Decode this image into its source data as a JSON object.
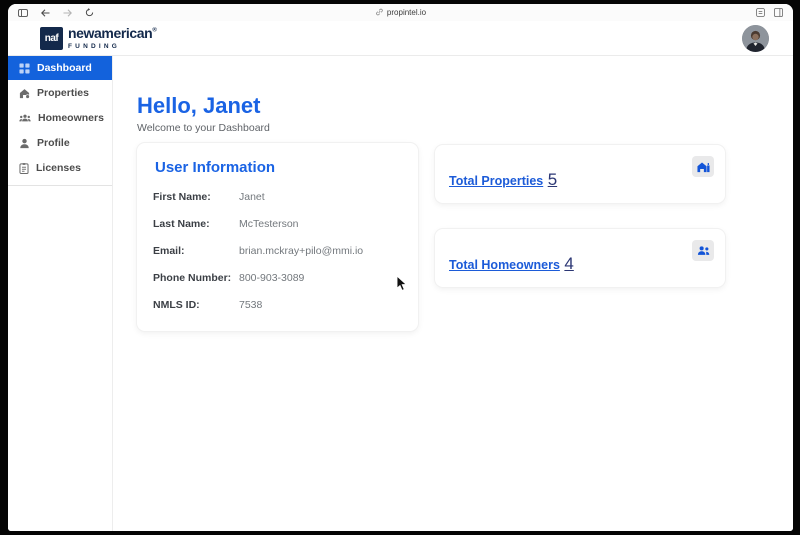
{
  "browser": {
    "url": "propintel.io",
    "icons": [
      "sidebar-toggle-icon",
      "back-arrow-icon",
      "forward-arrow-icon",
      "reload-icon",
      "link-icon",
      "reader-view-icon",
      "split-view-icon"
    ]
  },
  "header": {
    "brand": {
      "badge": "naf",
      "name": "newamerican",
      "reg": "®",
      "subname": "FUNDING"
    },
    "avatar": "user-profile-photo"
  },
  "sidebar": {
    "items": [
      {
        "label": "Dashboard",
        "icon": "dashboard-grid-icon",
        "active": true
      },
      {
        "label": "Properties",
        "icon": "house-icon",
        "active": false
      },
      {
        "label": "Homeowners",
        "icon": "group-icon",
        "active": false
      },
      {
        "label": "Profile",
        "icon": "person-icon",
        "active": false
      },
      {
        "label": "Licenses",
        "icon": "license-document-icon",
        "active": false
      }
    ]
  },
  "main": {
    "greeting": "Hello, Janet",
    "subtitle": "Welcome to your Dashboard",
    "user_info": {
      "title": "User Information",
      "fields": [
        {
          "label": "First Name:",
          "value": "Janet"
        },
        {
          "label": "Last Name:",
          "value": "McTesterson"
        },
        {
          "label": "Email:",
          "value": "brian.mckray+pilo@mmi.io"
        },
        {
          "label": "Phone Number:",
          "value": "800-903-3089"
        },
        {
          "label": "NMLS ID:",
          "value": "7538"
        }
      ]
    },
    "stats": [
      {
        "title": "Total Properties",
        "value": "5",
        "icon": "home-building-icon"
      },
      {
        "title": "Total Homeowners",
        "value": "4",
        "icon": "two-people-icon"
      }
    ]
  },
  "colors": {
    "accent_blue": "#1a63e4",
    "active_nav_blue": "#1362dc",
    "link_blue": "#1c5bd8",
    "brand_navy": "#13294b",
    "stat_number_navy": "#2b3674",
    "frame_black": "#050505"
  }
}
